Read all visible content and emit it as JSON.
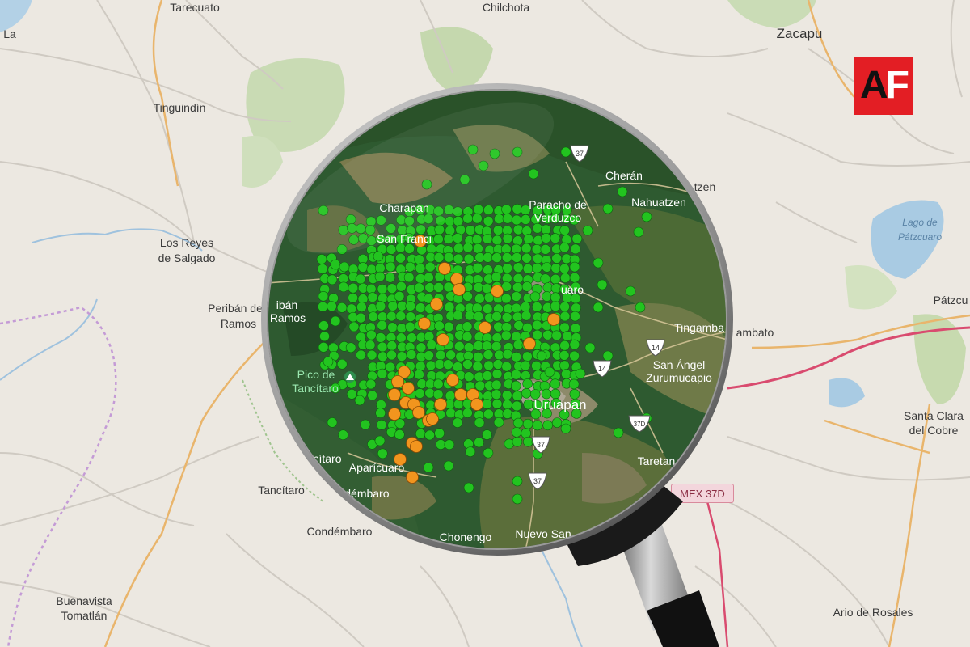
{
  "logo": {
    "letter_a": "A",
    "letter_f": "F",
    "bg_color": "#e31e24"
  },
  "base_labels": [
    {
      "key": "la",
      "text": "La"
    },
    {
      "key": "tarecuato",
      "text": "Tarecuato"
    },
    {
      "key": "chilchota",
      "text": "Chilchota"
    },
    {
      "key": "zacapu",
      "text": "Zacapu"
    },
    {
      "key": "tinguindin",
      "text": "Tinguindín"
    },
    {
      "key": "los_reyes",
      "text": "Los Reyes"
    },
    {
      "key": "de_salgado",
      "text": "de Salgado"
    },
    {
      "key": "periban",
      "text": "Peribán de"
    },
    {
      "key": "ramos_base",
      "text": "Ramos"
    },
    {
      "key": "ramos_lake",
      "text": "Lago de"
    },
    {
      "key": "patzcuaro_lake",
      "text": "Pátzcuaro"
    },
    {
      "key": "patzcu",
      "text": "Pátzcu"
    },
    {
      "key": "tingambato_base",
      "text": "ambato"
    },
    {
      "key": "nzen",
      "text": "tzen"
    },
    {
      "key": "tancitaro_base",
      "text": "Tancítaro"
    },
    {
      "key": "condembaro_base",
      "text": "Condémbaro"
    },
    {
      "key": "santa_clara",
      "text": "Santa Clara"
    },
    {
      "key": "del_cobre",
      "text": "del Cobre"
    },
    {
      "key": "buenavista",
      "text": "Buenavista"
    },
    {
      "key": "tomatlan",
      "text": "Tomatlán"
    },
    {
      "key": "ario",
      "text": "Ario de Rosales"
    }
  ],
  "road_badge": "MEX 37D",
  "lens_labels": [
    {
      "key": "cheran",
      "text": "Cherán"
    },
    {
      "key": "nahuatzen",
      "text": "Nahuatzen"
    },
    {
      "key": "charapan",
      "text": "Charapan"
    },
    {
      "key": "paracho",
      "text": "Paracho de"
    },
    {
      "key": "verduzco",
      "text": "Verduzco"
    },
    {
      "key": "san_francisco",
      "text": "San Franci"
    },
    {
      "key": "periban_lens",
      "text": "ibán"
    },
    {
      "key": "ramos_lens",
      "text": "Ramos"
    },
    {
      "key": "tingambato_lens",
      "text": "Tingamba"
    },
    {
      "key": "pico",
      "text": "Pico de"
    },
    {
      "key": "tancitaro_lens",
      "text": "Tancítaro"
    },
    {
      "key": "san_angel",
      "text": "San Ángel"
    },
    {
      "key": "zurumucapio",
      "text": "Zurumucapio"
    },
    {
      "key": "uruapan",
      "text": "Uruapan"
    },
    {
      "key": "taretan",
      "text": "Taretan"
    },
    {
      "key": "citaro",
      "text": "cítaro"
    },
    {
      "key": "aparicuaro",
      "text": "Aparícuaro"
    },
    {
      "key": "condembaro_lens",
      "text": "ndémbaro"
    },
    {
      "key": "chonengo",
      "text": "Chonengo"
    },
    {
      "key": "nuevo_san",
      "text": "Nuevo San"
    },
    {
      "key": "uaro",
      "text": "uaro"
    }
  ],
  "highway_shields": [
    "37",
    "14",
    "14",
    "37",
    "37",
    "37D"
  ],
  "marker_colors": {
    "green": "#22c41f",
    "orange": "#f2951e"
  },
  "markers_orange": [
    [
      -70,
      -82
    ],
    [
      -40,
      -48
    ],
    [
      -25,
      -35
    ],
    [
      -22,
      -22
    ],
    [
      -50,
      -4
    ],
    [
      25,
      -20
    ],
    [
      10,
      25
    ],
    [
      95,
      15
    ],
    [
      65,
      45
    ],
    [
      -65,
      20
    ],
    [
      -42,
      40
    ],
    [
      -90,
      80
    ],
    [
      -98,
      92
    ],
    [
      -85,
      100
    ],
    [
      -102,
      108
    ],
    [
      -88,
      118
    ],
    [
      -102,
      132
    ],
    [
      -78,
      120
    ],
    [
      -72,
      130
    ],
    [
      -60,
      140
    ],
    [
      -80,
      168
    ],
    [
      -95,
      188
    ],
    [
      -80,
      210
    ],
    [
      -55,
      138
    ],
    [
      -45,
      120
    ],
    [
      -30,
      90
    ],
    [
      -20,
      108
    ],
    [
      -5,
      108
    ],
    [
      0,
      120
    ],
    [
      -75,
      172
    ]
  ]
}
